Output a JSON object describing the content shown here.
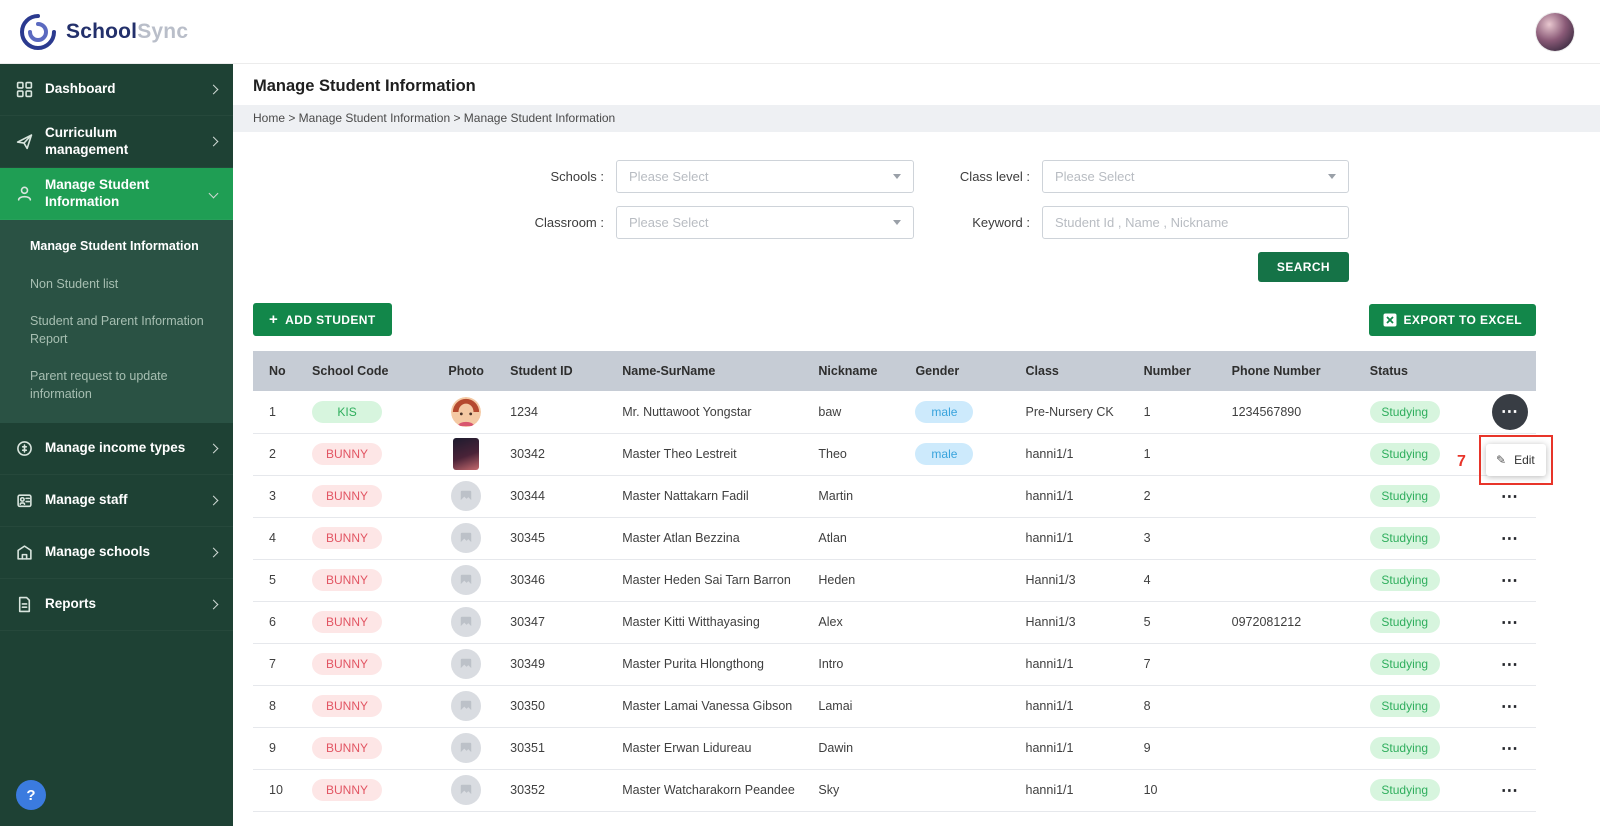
{
  "brand": {
    "name_primary": "School",
    "name_secondary": "Sync"
  },
  "sidebar": {
    "items": [
      {
        "label": "Dashboard"
      },
      {
        "label": "Curriculum management"
      },
      {
        "label": "Manage Student Information"
      },
      {
        "label": "Manage income types"
      },
      {
        "label": "Manage staff"
      },
      {
        "label": "Manage schools"
      },
      {
        "label": "Reports"
      }
    ],
    "submenu": [
      {
        "label": "Manage Student Information"
      },
      {
        "label": "Non Student list"
      },
      {
        "label": "Student and Parent Information Report"
      },
      {
        "label": "Parent request to update information"
      }
    ],
    "help_glyph": "?"
  },
  "page": {
    "title": "Manage Student Information",
    "breadcrumb": "Home > Manage Student Information > Manage Student Information"
  },
  "filters": {
    "schools_label": "Schools :",
    "class_level_label": "Class level :",
    "classroom_label": "Classroom :",
    "keyword_label": "Keyword :",
    "select_placeholder": "Please Select",
    "keyword_placeholder": "Student Id , Name , Nickname",
    "search_label": "SEARCH"
  },
  "toolbar": {
    "add_student_plus": "+",
    "add_student_label": "ADD STUDENT",
    "export_label": "EXPORT TO EXCEL"
  },
  "table": {
    "headers": [
      "No",
      "School Code",
      "Photo",
      "Student ID",
      "Name-SurName",
      "Nickname",
      "Gender",
      "Class",
      "Number",
      "Phone Number",
      "Status"
    ],
    "rows": [
      {
        "no": "1",
        "school_code": "KIS",
        "school_code_color": "green",
        "photo": "avatar-girl",
        "student_id": "1234",
        "name": "Mr. Nuttawoot Yongstar",
        "nickname": "baw",
        "gender": "male",
        "class": "Pre-Nursery CK",
        "number": "1",
        "phone": "1234567890",
        "status": "Studying",
        "action": "menu-open"
      },
      {
        "no": "2",
        "school_code": "BUNNY",
        "school_code_color": "pink",
        "photo": "avatar-photo",
        "student_id": "30342",
        "name": "Master Theo Lestreit",
        "nickname": "Theo",
        "gender": "male",
        "class": "hanni1/1",
        "number": "1",
        "phone": "",
        "status": "Studying",
        "action": "dots"
      },
      {
        "no": "3",
        "school_code": "BUNNY",
        "school_code_color": "pink",
        "photo": "placeholder",
        "student_id": "30344",
        "name": "Master Nattakarn Fadil",
        "nickname": "Martin",
        "gender": "",
        "class": "hanni1/1",
        "number": "2",
        "phone": "",
        "status": "Studying",
        "action": "dots"
      },
      {
        "no": "4",
        "school_code": "BUNNY",
        "school_code_color": "pink",
        "photo": "placeholder",
        "student_id": "30345",
        "name": "Master Atlan Bezzina",
        "nickname": "Atlan",
        "gender": "",
        "class": "hanni1/1",
        "number": "3",
        "phone": "",
        "status": "Studying",
        "action": "dots"
      },
      {
        "no": "5",
        "school_code": "BUNNY",
        "school_code_color": "pink",
        "photo": "placeholder",
        "student_id": "30346",
        "name": "Master Heden Sai Tarn Barron",
        "nickname": "Heden",
        "gender": "",
        "class": "Hanni1/3",
        "number": "4",
        "phone": "",
        "status": "Studying",
        "action": "dots"
      },
      {
        "no": "6",
        "school_code": "BUNNY",
        "school_code_color": "pink",
        "photo": "placeholder",
        "student_id": "30347",
        "name": "Master Kitti Witthayasing",
        "nickname": "Alex",
        "gender": "",
        "class": "Hanni1/3",
        "number": "5",
        "phone": "0972081212",
        "status": "Studying",
        "action": "dots"
      },
      {
        "no": "7",
        "school_code": "BUNNY",
        "school_code_color": "pink",
        "photo": "placeholder",
        "student_id": "30349",
        "name": "Master Purita Hlongthong",
        "nickname": "Intro",
        "gender": "",
        "class": "hanni1/1",
        "number": "7",
        "phone": "",
        "status": "Studying",
        "action": "dots"
      },
      {
        "no": "8",
        "school_code": "BUNNY",
        "school_code_color": "pink",
        "photo": "placeholder",
        "student_id": "30350",
        "name": "Master Lamai Vanessa Gibson",
        "nickname": "Lamai",
        "gender": "",
        "class": "hanni1/1",
        "number": "8",
        "phone": "",
        "status": "Studying",
        "action": "dots"
      },
      {
        "no": "9",
        "school_code": "BUNNY",
        "school_code_color": "pink",
        "photo": "placeholder",
        "student_id": "30351",
        "name": "Master Erwan Lidureau",
        "nickname": "Dawin",
        "gender": "",
        "class": "hanni1/1",
        "number": "9",
        "phone": "",
        "status": "Studying",
        "action": "dots"
      },
      {
        "no": "10",
        "school_code": "BUNNY",
        "school_code_color": "pink",
        "photo": "placeholder",
        "student_id": "30352",
        "name": "Master Watcharakorn Peandee",
        "nickname": "Sky",
        "gender": "",
        "class": "hanni1/1",
        "number": "10",
        "phone": "",
        "status": "Studying",
        "action": "dots"
      }
    ]
  },
  "row_menu": {
    "edit_label": "Edit"
  },
  "annotation": {
    "number": "7"
  },
  "colors": {
    "sidebar_bg": "#1e4134",
    "active_green": "#1f9e54",
    "button_green": "#12874a",
    "badge_green_text": "#2fae5d",
    "badge_pink_text": "#e25563",
    "badge_blue_text": "#38a3dc",
    "annotation_red": "#e8352a"
  }
}
